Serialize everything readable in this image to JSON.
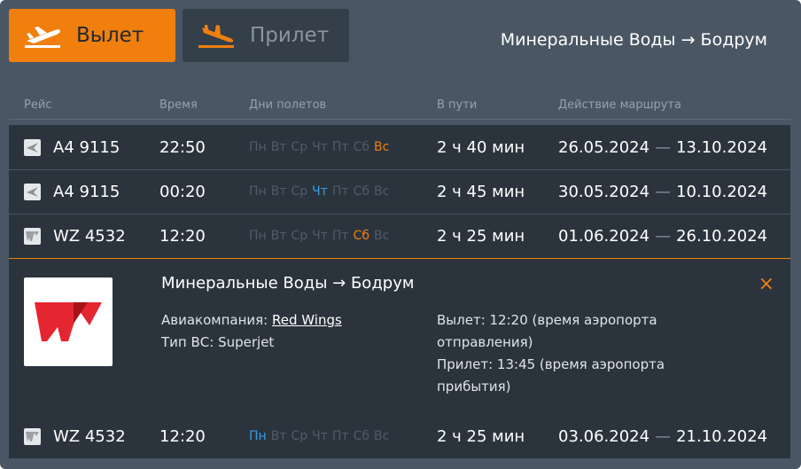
{
  "tabs": {
    "departure": {
      "label": "Вылет"
    },
    "arrival": {
      "label": "Прилет"
    }
  },
  "route_title": "Минеральные Воды → Бодрум",
  "columns": {
    "flight": "Рейс",
    "time": "Время",
    "days": "Дни полетов",
    "duration": "В пути",
    "validity": "Действие маршрута"
  },
  "rows": [
    {
      "airline_icon": "ural-airlines-logo",
      "flight": "A4 9115",
      "time": "22:50",
      "days": [
        "Пн",
        "Вт",
        "Ср",
        "Чт",
        "Пт",
        "Сб",
        "Вс"
      ],
      "active": [
        false,
        false,
        false,
        false,
        false,
        false,
        true
      ],
      "duration": "2 ч 40 мин",
      "from": "26.05.2024",
      "sep": "—",
      "to": "13.10.2024"
    },
    {
      "airline_icon": "ural-airlines-logo",
      "flight": "A4 9115",
      "time": "00:20",
      "days": [
        "Пн",
        "Вт",
        "Ср",
        "Чт",
        "Пт",
        "Сб",
        "Вс"
      ],
      "active": [
        false,
        false,
        false,
        true,
        false,
        false,
        false
      ],
      "duration": "2 ч 45 мин",
      "from": "30.05.2024",
      "sep": "—",
      "to": "10.10.2024"
    },
    {
      "airline_icon": "red-wings-logo",
      "flight": "WZ 4532",
      "time": "12:20",
      "days": [
        "Пн",
        "Вт",
        "Ср",
        "Чт",
        "Пт",
        "Сб",
        "Вс"
      ],
      "active": [
        false,
        false,
        false,
        false,
        false,
        true,
        false
      ],
      "duration": "2 ч 25 мин",
      "from": "01.06.2024",
      "sep": "—",
      "to": "26.10.2024"
    },
    {
      "airline_icon": "red-wings-logo",
      "flight": "WZ 4532",
      "time": "12:20",
      "days": [
        "Пн",
        "Вт",
        "Ср",
        "Чт",
        "Пт",
        "Сб",
        "Вс"
      ],
      "active": [
        true,
        false,
        false,
        false,
        false,
        false,
        false
      ],
      "duration": "2 ч 25 мин",
      "from": "03.06.2024",
      "sep": "—",
      "to": "21.10.2024"
    }
  ],
  "detail": {
    "title": "Минеральные Воды → Бодрум",
    "airline_label": "Авиакомпания:",
    "airline_name": "Red Wings",
    "aircraft_label": "Тип ВС:",
    "aircraft": "Superjet",
    "departure": "Вылет: 12:20 (время аэропорта отправления)",
    "arrival": "Прилет: 13:45 (время аэропорта прибытия)",
    "close": "×"
  },
  "colors": {
    "accent": "#f07f0e",
    "active_day_blue": "#3a9be0",
    "row_bg": "#2b343d",
    "panel_bg": "#4a5663"
  }
}
